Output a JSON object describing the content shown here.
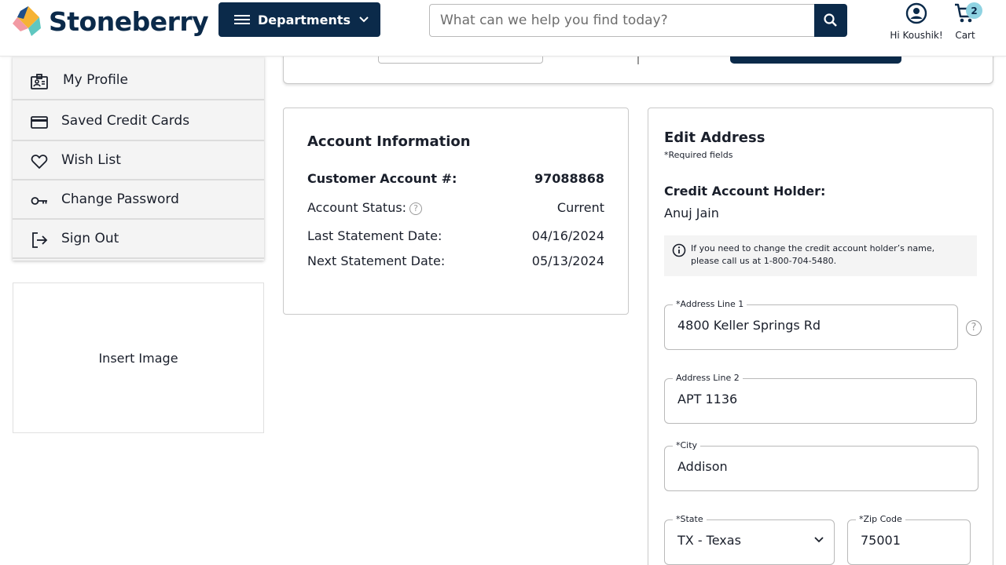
{
  "header": {
    "logo_text": "Stoneberry",
    "departments_label": "Departments",
    "search_placeholder": "What can we help you find today?",
    "account_label": "Hi Koushik!",
    "cart_label": "Cart",
    "cart_count": "2"
  },
  "sidebar": {
    "items": [
      {
        "label": "My Profile",
        "icon": "profile-card-icon"
      },
      {
        "label": "Saved Credit Cards",
        "icon": "credit-card-icon"
      },
      {
        "label": "Wish List",
        "icon": "heart-icon"
      },
      {
        "label": "Change Password",
        "icon": "key-icon"
      },
      {
        "label": "Sign Out",
        "icon": "sign-out-icon"
      }
    ],
    "image_placeholder": "Insert Image"
  },
  "account_info": {
    "title": "Account Information",
    "rows": [
      {
        "label": "Customer Account #:",
        "value": "97088868"
      },
      {
        "label": "Account Status:",
        "value": "Current"
      },
      {
        "label": "Last Statement Date:",
        "value": "04/16/2024"
      },
      {
        "label": "Next Statement Date:",
        "value": "05/13/2024"
      }
    ]
  },
  "edit_address": {
    "title": "Edit Address",
    "required_note": "*Required fields",
    "holder_label": "Credit Account Holder:",
    "holder_name": "Anuj Jain",
    "notice": "If you need to change the credit account holder’s name, please call us at 1-800-704-5480.",
    "fields": {
      "address1": {
        "label": "*Address Line 1",
        "value": "4800 Keller Springs Rd"
      },
      "address2": {
        "label": "Address Line 2",
        "value": "APT 1136"
      },
      "city": {
        "label": "*City",
        "value": "Addison"
      },
      "state": {
        "label": "*State",
        "value": "TX - Texas"
      },
      "zip": {
        "label": "*Zip Code",
        "value": "75001"
      }
    }
  },
  "colors": {
    "brand_navy": "#0b2a4a",
    "badge": "#8fd3e2"
  }
}
